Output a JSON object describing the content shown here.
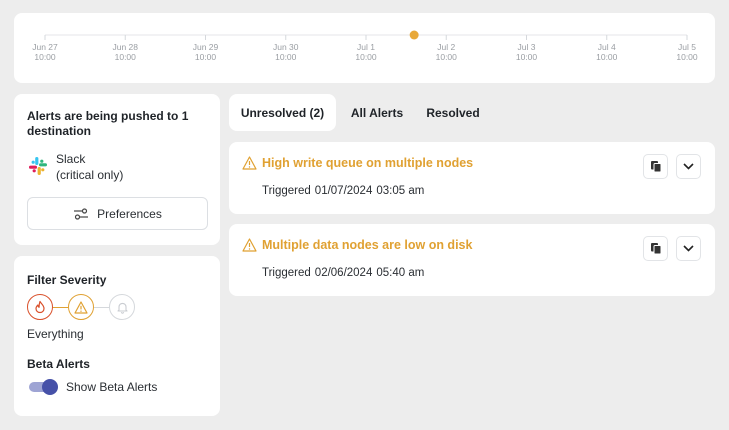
{
  "timeline": {
    "ticks": [
      {
        "date": "Jun 27",
        "time": "10:00"
      },
      {
        "date": "Jun 28",
        "time": "10:00"
      },
      {
        "date": "Jun 29",
        "time": "10:00"
      },
      {
        "date": "Jun 30",
        "time": "10:00"
      },
      {
        "date": "Jul 1",
        "time": "10:00"
      },
      {
        "date": "Jul 2",
        "time": "10:00"
      },
      {
        "date": "Jul 3",
        "time": "10:00"
      },
      {
        "date": "Jul 4",
        "time": "10:00"
      },
      {
        "date": "Jul 5",
        "time": "10:00"
      }
    ],
    "event_color": "#e8a838"
  },
  "destinations": {
    "title": "Alerts are being pushed to 1 destination",
    "slack_name": "Slack",
    "slack_scope": "(critical only)",
    "slack_icon": "slack-icon",
    "preferences_label": "Preferences",
    "preferences_icon": "sliders-icon"
  },
  "filter": {
    "title": "Filter Severity",
    "levels": [
      {
        "name": "critical",
        "icon": "flame-icon",
        "color": "#d9502b",
        "active": true
      },
      {
        "name": "warning",
        "icon": "warning-icon",
        "color": "#e0a132",
        "active": true
      },
      {
        "name": "info",
        "icon": "bell-icon",
        "color": "#c9ccd1",
        "active": false
      }
    ],
    "selection_label": "Everything"
  },
  "beta": {
    "title": "Beta Alerts",
    "toggle_label": "Show Beta Alerts",
    "toggle_on": true
  },
  "tabs": [
    {
      "label": "Unresolved (2)",
      "active": true
    },
    {
      "label": "All Alerts",
      "active": false
    },
    {
      "label": "Resolved",
      "active": false
    }
  ],
  "alerts": [
    {
      "title": "High write queue on multiple nodes",
      "triggered_label": "Triggered",
      "date": "01/07/2024",
      "time": "03:05 am",
      "severity_icon": "warning-icon"
    },
    {
      "title": "Multiple data nodes are low on disk",
      "triggered_label": "Triggered",
      "date": "02/06/2024",
      "time": "05:40 am",
      "severity_icon": "warning-icon"
    }
  ],
  "colors": {
    "accent": "#4651a8",
    "warning": "#e0a132",
    "critical": "#d9502b",
    "background": "#ededed"
  }
}
